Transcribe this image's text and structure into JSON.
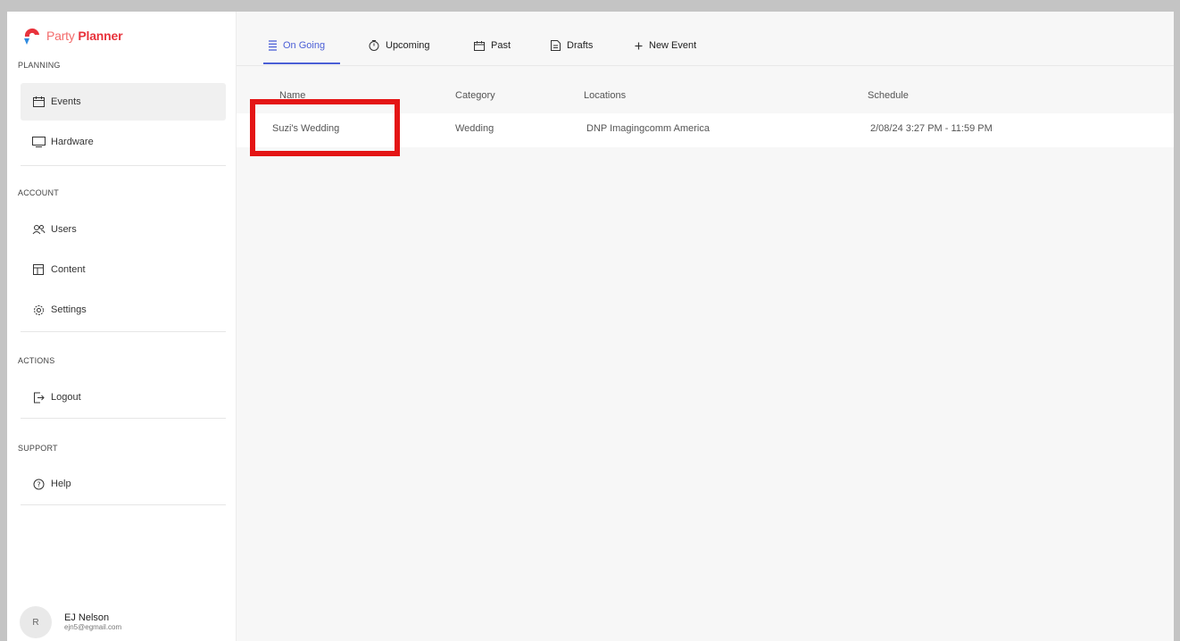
{
  "app": {
    "logo_text_1": "Party",
    "logo_text_2": "Planner"
  },
  "sidebar": {
    "sections": [
      {
        "label": "PLANNING"
      },
      {
        "label": "ACCOUNT"
      },
      {
        "label": "ACTIONS"
      },
      {
        "label": "SUPPORT"
      }
    ],
    "items": [
      {
        "label": "Events",
        "icon": "calendar-icon"
      },
      {
        "label": "Hardware",
        "icon": "monitor-icon"
      },
      {
        "label": "Users",
        "icon": "users-icon"
      },
      {
        "label": "Content",
        "icon": "content-icon"
      },
      {
        "label": "Settings",
        "icon": "gear-icon"
      },
      {
        "label": "Logout",
        "icon": "logout-icon"
      },
      {
        "label": "Help",
        "icon": "help-icon"
      }
    ],
    "user": {
      "initial": "R",
      "name": "EJ Nelson",
      "email": "ejn5@egmail.com"
    }
  },
  "tabs": [
    {
      "label": "On Going",
      "icon": "list-icon"
    },
    {
      "label": "Upcoming",
      "icon": "clock-icon"
    },
    {
      "label": "Past",
      "icon": "calendar-icon"
    },
    {
      "label": "Drafts",
      "icon": "draft-icon"
    },
    {
      "label": "New Event",
      "icon": "plus-icon"
    }
  ],
  "table": {
    "columns": [
      "Name",
      "Category",
      "Locations",
      "Schedule"
    ],
    "rows": [
      {
        "name": "Suzi's Wedding",
        "category": "Wedding",
        "location": "DNP Imagingcomm America",
        "schedule": "2/08/24 3:27 PM - 11:59 PM"
      }
    ]
  },
  "colors": {
    "accent": "#4b5fd6",
    "brand": "#e8333c",
    "highlight": "#e41515"
  }
}
